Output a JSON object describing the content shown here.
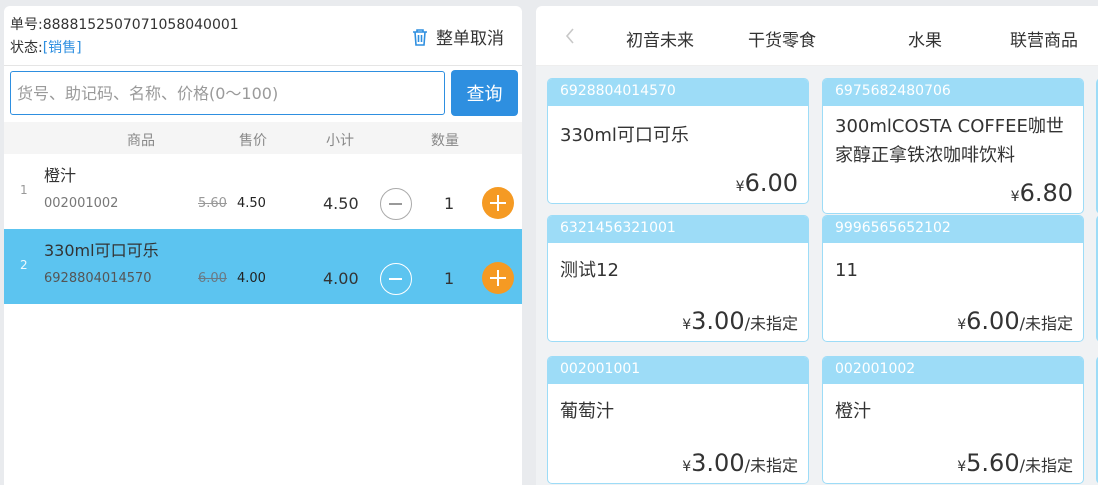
{
  "order": {
    "number_label": "单号:",
    "number": "8888152507071058040001",
    "status_label": "状态:",
    "status": "[销售]",
    "cancel_all": "整单取消"
  },
  "search": {
    "placeholder": "货号、助记码、名称、价格(0～100)",
    "value": "",
    "button": "查询"
  },
  "columns": {
    "product": "商品",
    "price": "售价",
    "subtotal": "小计",
    "qty": "数量"
  },
  "cart": [
    {
      "index": "1",
      "name": "橙汁",
      "code": "002001002",
      "original_price": "5.60",
      "price": "4.50",
      "subtotal": "4.50",
      "qty": "1",
      "selected": false
    },
    {
      "index": "2",
      "name": "330ml可口可乐",
      "code": "6928804014570",
      "original_price": "6.00",
      "price": "4.00",
      "subtotal": "4.00",
      "qty": "1",
      "selected": true
    }
  ],
  "categories": {
    "back": "‹",
    "tabs": [
      "初音未来",
      "干货零食",
      "水果",
      "联营商品"
    ]
  },
  "products": [
    {
      "barcode": "6928804014570",
      "name": "330ml可口可乐",
      "currency": "¥",
      "price": "6.00",
      "unit": ""
    },
    {
      "barcode": "6975682480706",
      "name": "300mlCOSTA COFFEE咖世家醇正拿铁浓咖啡饮料",
      "currency": "¥",
      "price": "6.80",
      "unit": ""
    },
    {
      "barcode": "6321456321001",
      "name": "测试12",
      "currency": "¥",
      "price": "3.00",
      "unit": "/未指定"
    },
    {
      "barcode": "9996565652102",
      "name": "11",
      "currency": "¥",
      "price": "6.00",
      "unit": "/未指定"
    },
    {
      "barcode": "002001001",
      "name": "葡萄汁",
      "currency": "¥",
      "price": "3.00",
      "unit": "/未指定"
    },
    {
      "barcode": "002001002",
      "name": "橙汁",
      "currency": "¥",
      "price": "5.60",
      "unit": "/未指定"
    }
  ],
  "colors": {
    "accent": "#2e8fe0",
    "selected_row": "#5cc4f0",
    "plus": "#f59a23",
    "card_header": "#9ddcf7"
  }
}
